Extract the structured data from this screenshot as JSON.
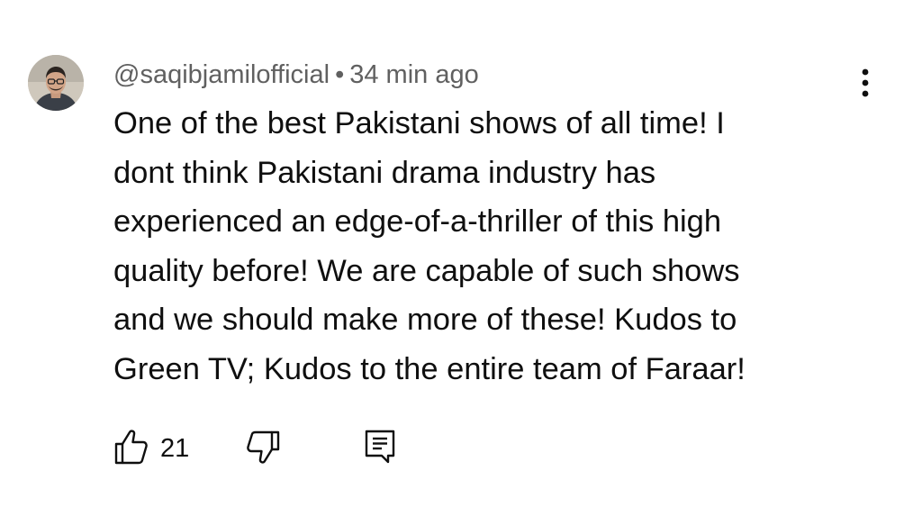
{
  "comment": {
    "author": "@saqibjamilofficial",
    "separator": "•",
    "timestamp": "34 min ago",
    "text": "One of the best Pakistani shows of all time! I\ndont think Pakistani drama industry has\nexperienced an edge-of-a-thriller of this high\nquality before! We are capable of such shows\nand we should make more of these! Kudos to\nGreen TV; Kudos to the entire team of Faraar!",
    "like_count": "21"
  },
  "icons": {
    "avatar": "user-avatar",
    "more": "more-vert-icon",
    "like": "thumb-up-icon",
    "dislike": "thumb-down-icon",
    "reply": "comment-reply-icon"
  },
  "colors": {
    "text_primary": "#0f0f0f",
    "text_secondary": "#606060",
    "background": "#ffffff"
  }
}
